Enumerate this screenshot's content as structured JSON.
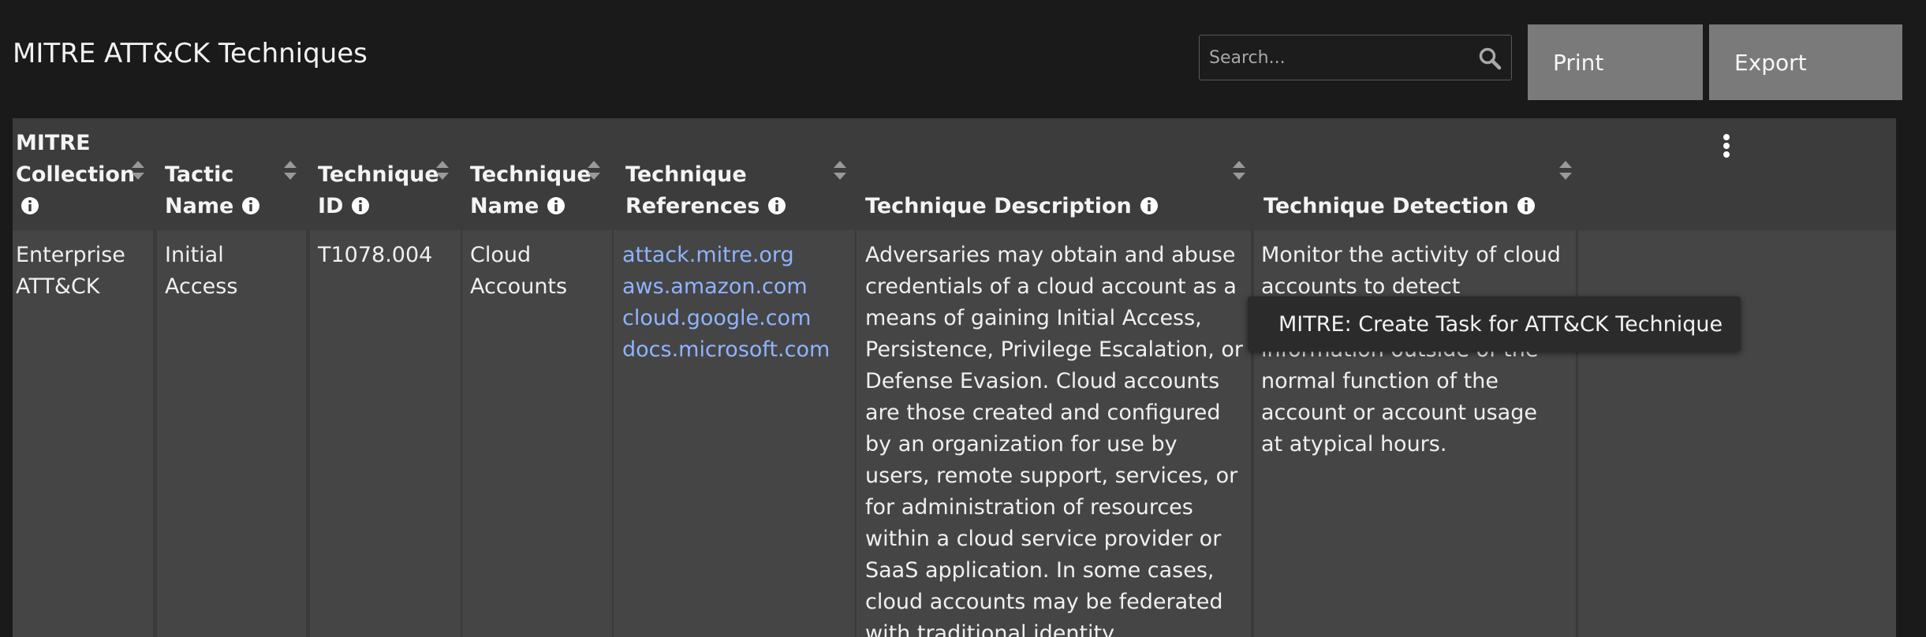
{
  "page": {
    "title": "MITRE ATT&CK Techniques"
  },
  "toolbar": {
    "search_placeholder": "Search...",
    "print_label": "Print",
    "export_label": "Export"
  },
  "table": {
    "columns": [
      {
        "label": "MITRE Collection",
        "lines": [
          "MITRE",
          "Collection"
        ]
      },
      {
        "label": "Tactic Name",
        "lines": [
          "Tactic",
          "Name"
        ]
      },
      {
        "label": "Technique ID",
        "lines": [
          "Technique",
          "ID"
        ]
      },
      {
        "label": "Technique Name",
        "lines": [
          "Technique",
          "Name"
        ]
      },
      {
        "label": "Technique References",
        "lines": [
          "Technique",
          "References"
        ]
      },
      {
        "label": "Technique Description",
        "lines": [
          "Technique Description"
        ]
      },
      {
        "label": "Technique Detection",
        "lines": [
          "Technique Detection"
        ]
      }
    ],
    "rows": [
      {
        "collection": "Enterprise ATT&CK",
        "tactic": "Initial Access",
        "technique_id": "T1078.004",
        "technique_name": "Cloud Accounts",
        "references": [
          "attack.mitre.org",
          "aws.amazon.com",
          "cloud.google.com",
          "docs.microsoft.com"
        ],
        "description": "Adversaries may obtain and abuse credentials of a cloud account as a means of gaining Initial Access, Persistence, Privilege Escalation, or Defense Evasion. Cloud accounts are those created and configured by an organization for use by users, remote support, services, or for administration of resources within a cloud service provider or SaaS application. In some cases, cloud accounts may be federated with traditional identity management",
        "detection": "Monitor the activity of cloud accounts to detect abnormal accessing information outside of the normal function of the account or account usage at atypical hours."
      }
    ]
  },
  "context_menu": {
    "item": "MITRE: Create Task for ATT&CK Technique"
  },
  "colors": {
    "background": "#1a1a1a",
    "button": "#7a7a7a",
    "link": "#8fb4ff",
    "cell": "#454545"
  }
}
